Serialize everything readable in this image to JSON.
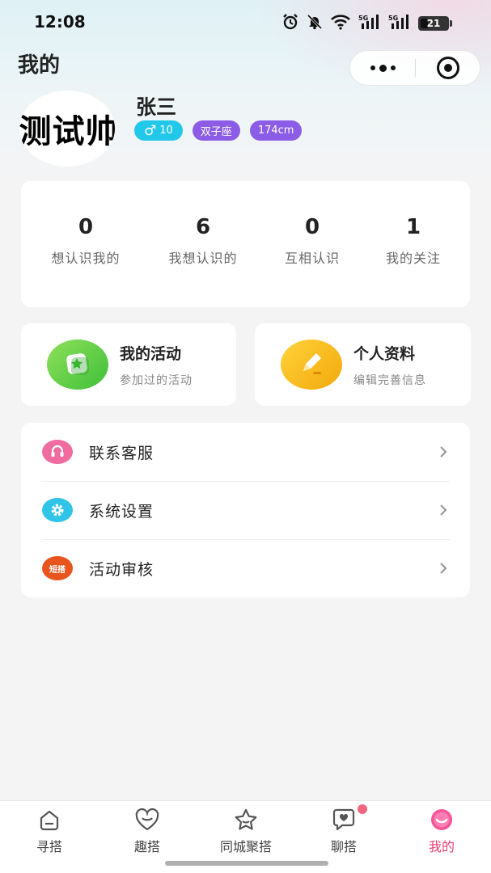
{
  "status": {
    "time": "12:08",
    "battery": "21",
    "signal1": "5G",
    "signal2": "5G"
  },
  "header": {
    "title": "我的"
  },
  "profile": {
    "avatar_text": "测试帅",
    "name": "张三",
    "gender_symbol": "♂",
    "age": "10",
    "zodiac": "双子座",
    "height": "174cm"
  },
  "stats": [
    {
      "value": "0",
      "label": "想认识我的"
    },
    {
      "value": "6",
      "label": "我想认识的"
    },
    {
      "value": "0",
      "label": "互相认识"
    },
    {
      "value": "1",
      "label": "我的关注"
    }
  ],
  "shortcuts": [
    {
      "title": "我的活动",
      "subtitle": "参加过的活动",
      "icon": "activity-icon",
      "color": "#5cc93a"
    },
    {
      "title": "个人资料",
      "subtitle": "编辑完善信息",
      "icon": "edit-icon",
      "color": "#f5b311"
    }
  ],
  "menu": [
    {
      "label": "联系客服",
      "icon": "headset-icon",
      "color": "#f06ba0"
    },
    {
      "label": "系统设置",
      "icon": "gear-icon",
      "color": "#2fc4e8"
    },
    {
      "label": "活动审核",
      "icon": "review-icon",
      "icon_text": "短搭",
      "color": "#e8541e"
    }
  ],
  "tabs": [
    {
      "label": "寻搭",
      "icon": "home-icon"
    },
    {
      "label": "趣搭",
      "icon": "heart-icon"
    },
    {
      "label": "同城聚搭",
      "icon": "star-icon"
    },
    {
      "label": "聊搭",
      "icon": "chat-heart-icon"
    },
    {
      "label": "我的",
      "icon": "smile-icon",
      "active": true
    }
  ],
  "colors": {
    "accent": "#ee3f73",
    "gender_tag": "#22c8ea",
    "purple_tag": "#8c5ce6",
    "badge": "#f0677f"
  }
}
